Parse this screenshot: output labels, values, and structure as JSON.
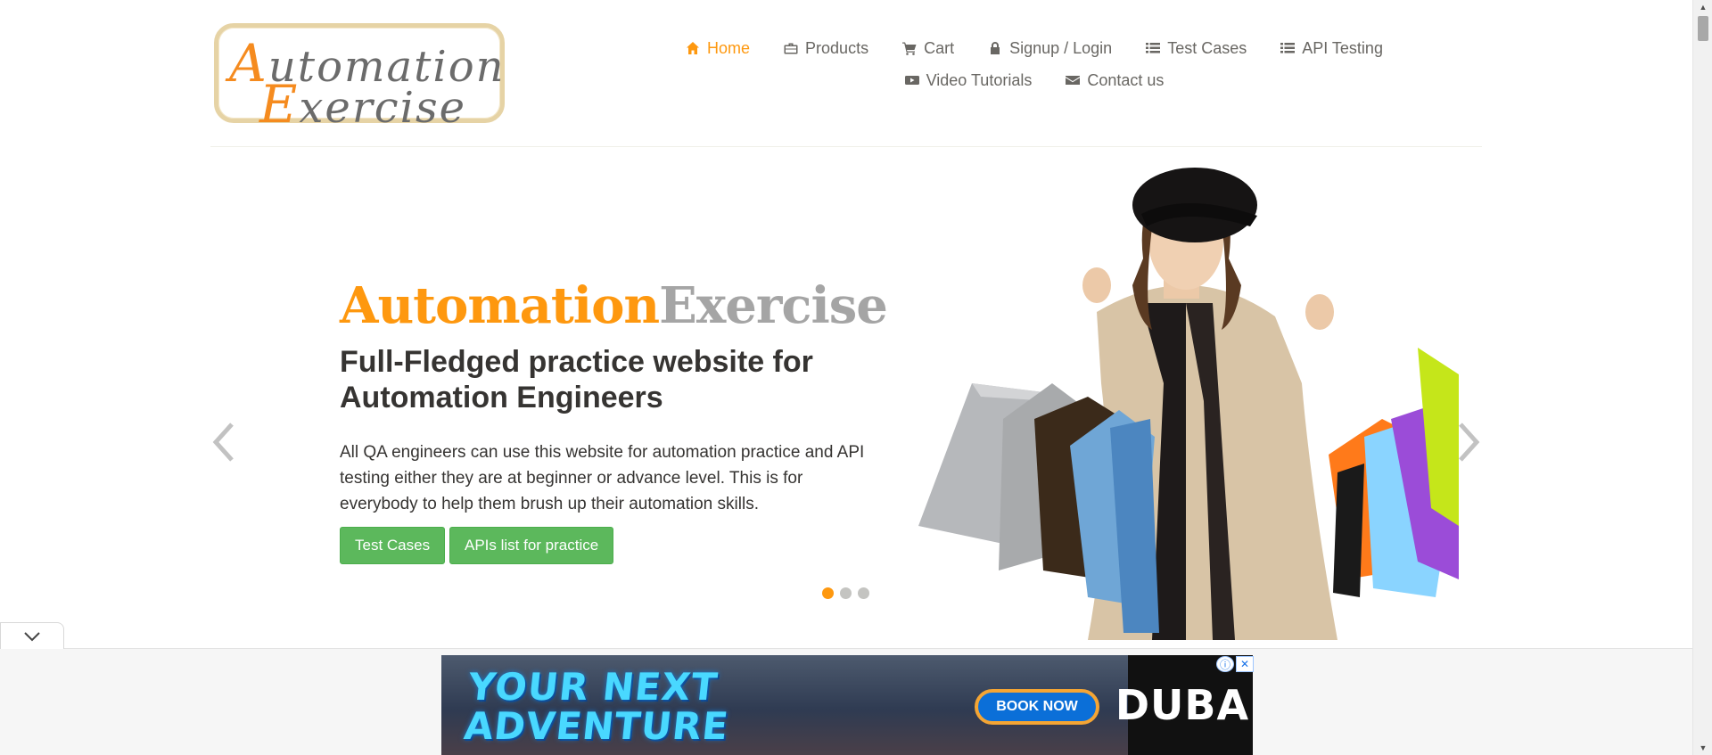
{
  "logo": {
    "line1_cap": "A",
    "line1_rest": "utomation",
    "line2_cap": "E",
    "line2_rest": "xercise"
  },
  "nav": {
    "items": [
      {
        "label": "Home",
        "icon": "home-icon",
        "active": true
      },
      {
        "label": "Products",
        "icon": "briefcase-icon"
      },
      {
        "label": "Cart",
        "icon": "cart-icon"
      },
      {
        "label": "Signup / Login",
        "icon": "lock-icon"
      },
      {
        "label": "Test Cases",
        "icon": "list-icon"
      },
      {
        "label": "API Testing",
        "icon": "list-icon"
      },
      {
        "label": "Video Tutorials",
        "icon": "youtube-play-icon"
      },
      {
        "label": "Contact us",
        "icon": "envelope-icon"
      }
    ]
  },
  "slider": {
    "brand_part1": "Automation",
    "brand_part2": "Exercise",
    "headline": "Full-Fledged practice website for Automation Engineers",
    "description": "All QA engineers can use this website for automation practice and API testing either they are at beginner or advance level. This is for everybody to help them brush up their automation skills.",
    "btn_test_cases": "Test Cases",
    "btn_apis": "APIs list for practice",
    "active_slide": 1,
    "slide_count": 3
  },
  "ad": {
    "headline_line1": "YOUR NEXT",
    "headline_line2": "ADVENTURE",
    "cta": "BOOK NOW",
    "brand": "DUBAI",
    "info_symbol": "ⓘ",
    "close_symbol": "✕"
  },
  "colors": {
    "accent": "#fe980f",
    "button": "#5cb85c",
    "text": "#696763",
    "heading": "#363432"
  }
}
